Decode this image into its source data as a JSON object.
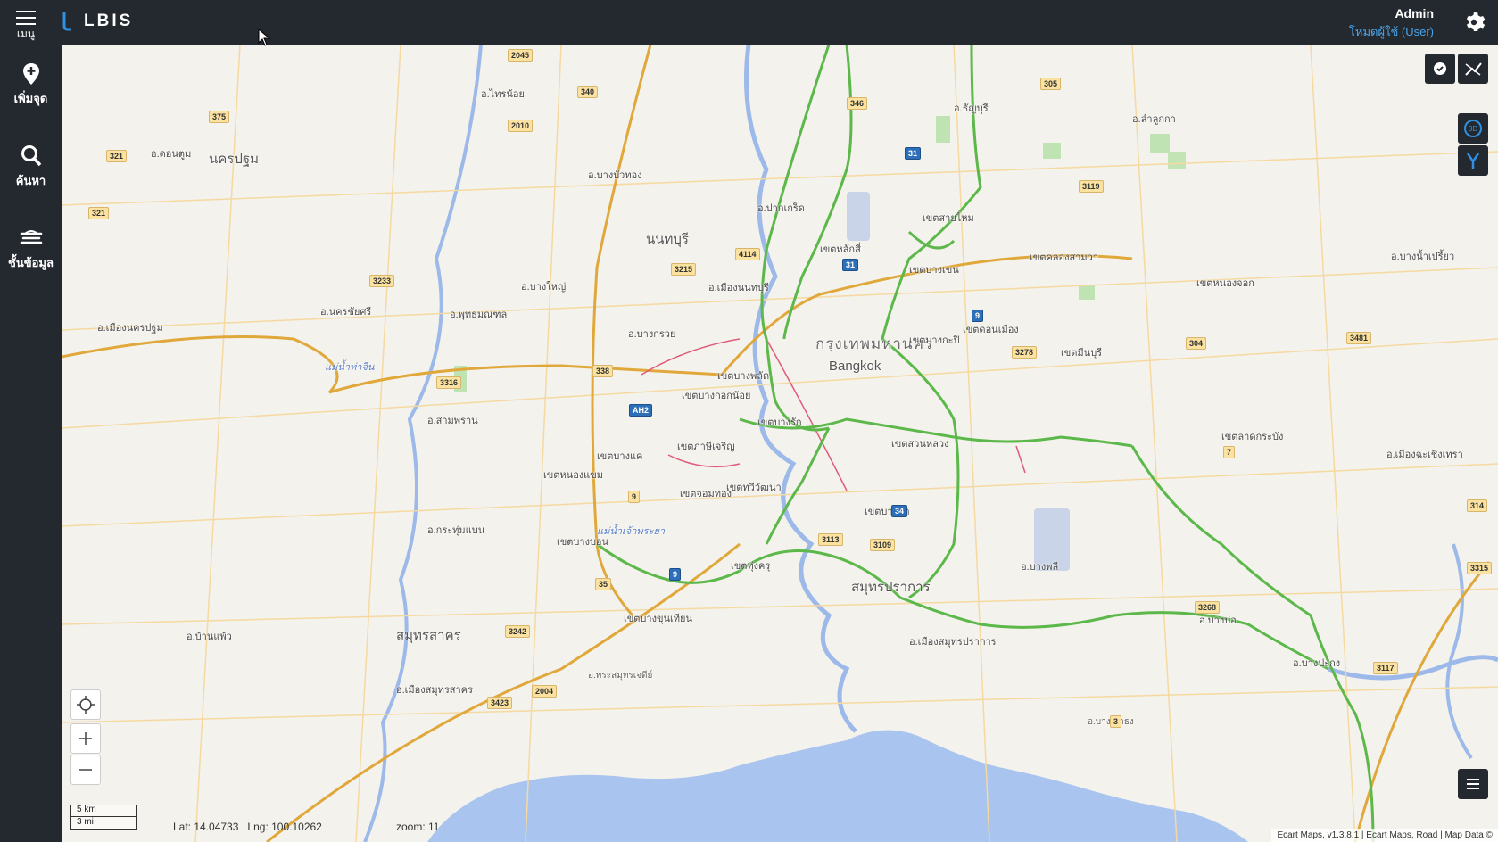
{
  "topbar": {
    "menu_label": "เมนู",
    "logo_text": "LBIS",
    "user_name": "Admin",
    "user_mode": "โหมดผู้ใช้ (User)"
  },
  "sidebar": {
    "items": [
      {
        "label": "เพิ่มจุด",
        "icon": "map-pin-icon"
      },
      {
        "label": "ค้นหา",
        "icon": "search-icon"
      },
      {
        "label": "ชั้นข้อมูล",
        "icon": "layers-icon"
      }
    ]
  },
  "map": {
    "coords": {
      "lat": "Lat: 14.04733",
      "lng": "Lng: 100.10262"
    },
    "zoom": "zoom: 11",
    "scale": {
      "km": "5 km",
      "mi": "3 mi"
    },
    "attribution": "Ecart Maps, v1.3.8.1 | Ecart Maps, Road | Map Data ©",
    "labels": {
      "bangkok_th": "กรุงเทพมหานคร",
      "bangkok_en": "Bangkok",
      "nonthaburi": "นนทบุรี",
      "nakhon_pathom": "นครปฐม",
      "samut_prakan": "สมุทรปราการ",
      "samut_sakhon": "สมุทรสาคร",
      "sainoi": "อ.ไทรน้อย",
      "bang_bua_thong": "อ.บางบัวทอง",
      "pak_kret": "อ.ปากเกร็ด",
      "muang_nonthaburi": "อ.เมืองนนทบุรี",
      "bang_yai": "อ.บางใหญ่",
      "bang_kruai": "อ.บางกรวย",
      "lak_si": "เขตหลักสี่",
      "sai_mai": "เขตสายไหม",
      "bang_khen": "เขตบางเขน",
      "khlong_sam_wa": "เขตคลองสามวา",
      "nong_chok": "เขตหนองจอก",
      "min_buri": "เขตมีนบุรี",
      "lat_krabang": "เขตลาดกระบัง",
      "suan_luang": "เขตสวนหลวง",
      "bang_phlat": "เขตบางพลัด",
      "thawi_watthana": "เขตทวีวัฒนา",
      "bang_khae": "เขตบางแค",
      "nong_khaem": "เขตหนองแขม",
      "chom_thong": "เขตจอมทอง",
      "bang_khun_thian": "เขตบางขุนเทียน",
      "thung_khru": "เขตทุ่งครุ",
      "bang_bon": "เขตบางบอน",
      "muang_samut_prakan": "อ.เมืองสมุทรปราการ",
      "bang_phli": "อ.บางพลี",
      "bang_bo": "อ.บางบ่อ",
      "muang_samut_sakhon": "อ.เมืองสมุทรสาคร",
      "krathum_baen": "อ.กระทุ่มแบน",
      "sam_phran": "อ.สามพราน",
      "phutthamonthon": "อ.พุทธมณฑล",
      "nakhon_chai_si": "อ.นครชัยศรี",
      "muang_nakhon_pathom": "อ.เมืองนครปฐม",
      "lam_luk_ka": "อ.ลำลูกกา",
      "thanyaburi": "อ.ธัญบุรี",
      "bang_pakong": "อ.บางปะกง",
      "muang_chachoengsao": "อ.เมืองฉะเชิงเทรา",
      "bang_nam_priao": "อ.บางน้ำเปรี้ยว",
      "phra_samut_chedi": "อ.พระสมุทรเจดีย์",
      "don_tum": "อ.ดอนตูม",
      "ban_phaeo": "อ.บ้านแพ้ว",
      "bang_sao_thong": "อ.บางเสาธง",
      "tha_chin": "แม่น้ำท่าจีน",
      "chao_phraya": "แม่น้ำเจ้าพระยา",
      "don_mueang": "เขตดอนเมือง",
      "bang_kapi": "เขตบางกะปิ",
      "bang_na": "เขตบางนา",
      "phasi_charoen": "เขตภาษีเจริญ",
      "bang_rak": "เขตบางรัก",
      "bangkok_noi": "เขตบางกอกน้อย"
    },
    "shields": [
      "2045",
      "340",
      "2010",
      "375",
      "321",
      "321",
      "3233",
      "3316",
      "338",
      "AH2",
      "9",
      "9",
      "3215",
      "4114",
      "31",
      "31",
      "9",
      "3278",
      "304",
      "3481",
      "3119",
      "305",
      "346",
      "3242",
      "3423",
      "2004",
      "3113",
      "3109",
      "34",
      "3268",
      "3117",
      "3",
      "314",
      "3315",
      "35",
      "7"
    ]
  }
}
